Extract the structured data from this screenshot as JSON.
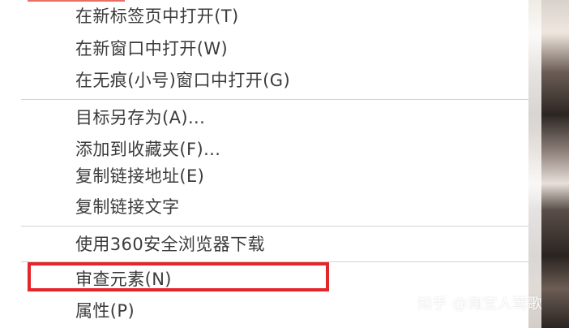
{
  "menu": {
    "items": [
      {
        "label": "在新标签页中打开(T)"
      },
      {
        "label": "在新窗口中打开(W)"
      },
      {
        "label": "在无痕(小号)窗口中打开(G)"
      },
      {
        "label": "目标另存为(A)..."
      },
      {
        "label": "添加到收藏夹(F)..."
      },
      {
        "label": "复制链接地址(E)"
      },
      {
        "label": "复制链接文字"
      },
      {
        "label": "使用360安全浏览器下载"
      },
      {
        "label": "审查元素(N)"
      },
      {
        "label": "属性(P)"
      }
    ]
  },
  "watermark": {
    "text": "知乎 @淘宝人莺歌"
  },
  "colors": {
    "highlight": "#e3262a",
    "menu_text": "#3b3b3b",
    "separator": "#d3d3d3"
  }
}
